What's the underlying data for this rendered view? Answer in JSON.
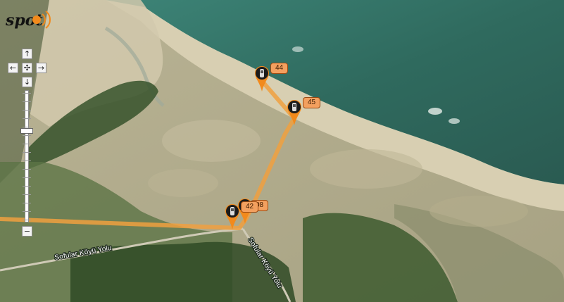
{
  "logo": {
    "text": "spot",
    "icon": "signal-waves-icon",
    "accent": "#f28a1c"
  },
  "controls": {
    "pan_up": "↑",
    "pan_left": "←",
    "pan_center": "✣",
    "pan_right": "→",
    "pan_down": "↓",
    "zoom_out": "−"
  },
  "zoom": {
    "tick_count": 16,
    "level_fraction": 0.7
  },
  "roads": [
    {
      "name": "Sofular Köyü Yolu"
    },
    {
      "name": "Sofular Köyü Yolu"
    }
  ],
  "markers": [
    {
      "id": "44",
      "label": "44"
    },
    {
      "id": "45",
      "label": "45"
    },
    {
      "id": "42",
      "label": "42"
    },
    {
      "id": "08",
      "label": "08"
    }
  ],
  "colors": {
    "track": "#f0a040",
    "sea_deep": "#2f5f55",
    "sea_shallow": "#3f8a7a",
    "sand": "#cfc5a8",
    "forest": "#3c5a2c",
    "marker_label_bg": "#f3a05f"
  }
}
